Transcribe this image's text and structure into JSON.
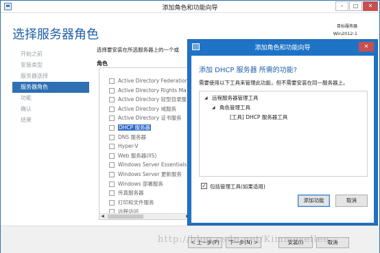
{
  "main_window": {
    "title": "添加角色和功能向导",
    "window_buttons": {
      "minimize": "–",
      "maximize": "□",
      "close": "✕"
    },
    "page_title": "选择服务器角色",
    "target_label": "目标服务器",
    "target_value": "Win2012-1",
    "sidebar": [
      {
        "label": "开始之前",
        "active": false
      },
      {
        "label": "安装类型",
        "active": false
      },
      {
        "label": "服务器选择",
        "active": false
      },
      {
        "label": "服务器角色",
        "active": true
      },
      {
        "label": "功能",
        "active": false
      },
      {
        "label": "确认",
        "active": false
      },
      {
        "label": "结果",
        "active": false
      }
    ],
    "intro": "选择要安装在所选服务器上的一个或",
    "roles_header": "角色",
    "roles": [
      {
        "label": "Active Directory Federation",
        "selected": false
      },
      {
        "label": "Active Directory Rights Ma",
        "selected": false
      },
      {
        "label": "Active Directory 轻型目录服",
        "selected": false
      },
      {
        "label": "Active Directory 域服务",
        "selected": false
      },
      {
        "label": "Active Directory 证书服务",
        "selected": false
      },
      {
        "label": "DHCP 服务器",
        "selected": true
      },
      {
        "label": "DNS 服务器",
        "selected": false
      },
      {
        "label": "Hyper-V",
        "selected": false
      },
      {
        "label": "Web 服务器(IIS)",
        "selected": false
      },
      {
        "label": "Windows Server Essentials",
        "selected": false
      },
      {
        "label": "Windows Server 更新服务",
        "selected": false
      },
      {
        "label": "Windows 部署服务",
        "selected": false
      },
      {
        "label": "传真服务器",
        "selected": false
      },
      {
        "label": "打印和文件服务",
        "selected": false
      },
      {
        "label": "远程访问",
        "selected": false
      }
    ],
    "footer": {
      "prev": "< 上一步(P)",
      "next": "下一步(N) >",
      "install": "安装(I)",
      "cancel": "取消"
    }
  },
  "dialog": {
    "title": "添加角色和功能向导",
    "close": "✕",
    "heading": "添加 DHCP 服务器 所需的功能?",
    "description": "需要使用以下工具来管理此功能，但不需要安装在同一服务器上。",
    "tree": {
      "node1": "远程服务器管理工具",
      "node2": "角色管理工具",
      "node3": "[工具] DHCP 服务器工具"
    },
    "include_tools_label": "包括管理工具(如果适用)",
    "include_tools_checked": true,
    "checkmark": "✓",
    "add_button": "添加功能",
    "cancel_button": "取消"
  },
  "watermark": "http://blog.csdn.net/Kimmosellee"
}
